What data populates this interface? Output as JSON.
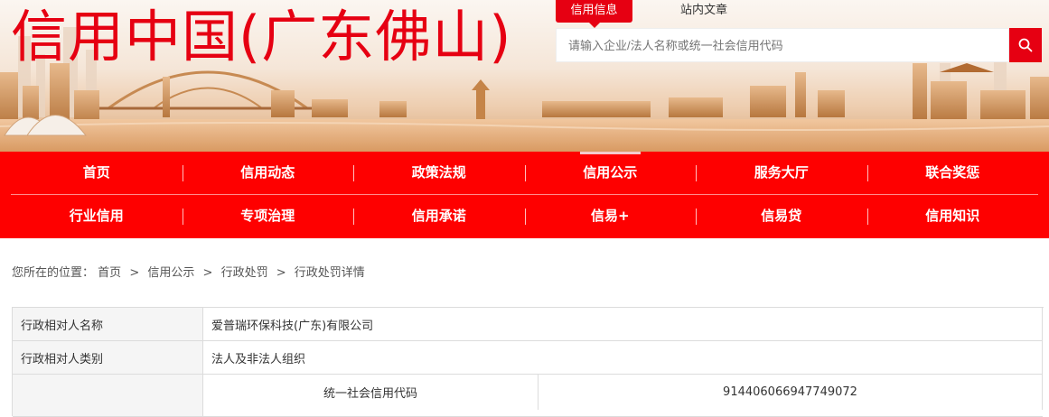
{
  "banner": {
    "site_title": "信用中国(广东佛山)"
  },
  "search": {
    "tabs": [
      "信用信息",
      "站内文章"
    ],
    "placeholder": "请输入企业/法人名称或统一社会信用代码",
    "button_icon": "search-icon"
  },
  "nav": {
    "row1": [
      "首页",
      "信用动态",
      "政策法规",
      "信用公示",
      "服务大厅",
      "联合奖惩"
    ],
    "row2": [
      "行业信用",
      "专项治理",
      "信用承诺",
      "信易+",
      "信易贷",
      "信用知识"
    ],
    "active": "信用公示"
  },
  "breadcrumb": {
    "prefix": "您所在的位置：",
    "items": [
      "首页",
      "信用公示",
      "行政处罚",
      "行政处罚详情"
    ],
    "separator": ">"
  },
  "detail": {
    "rows": [
      {
        "label": "行政相对人名称",
        "value": "爱普瑞环保科技(广东)有限公司"
      },
      {
        "label": "行政相对人类别",
        "value": "法人及非法人组织"
      }
    ],
    "code_row": {
      "label": "",
      "name": "统一社会信用代码",
      "value": "914406066947749072"
    }
  },
  "colors": {
    "brand_red": "#e60012",
    "nav_red": "#fe0000"
  }
}
